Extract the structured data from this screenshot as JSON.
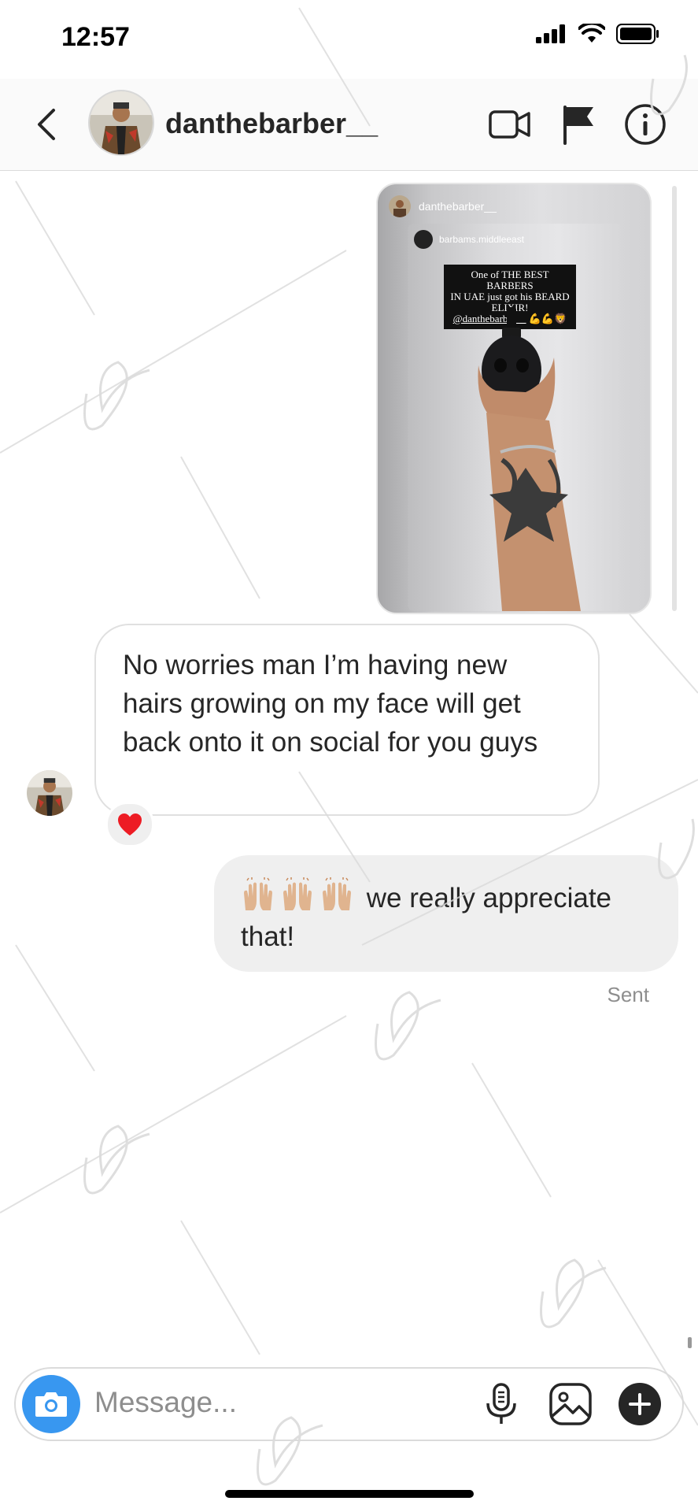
{
  "status_bar": {
    "time": "12:57"
  },
  "header": {
    "username": "danthebarber__"
  },
  "story": {
    "owner": "danthebarber__",
    "inner_owner": "barbams.middleeast",
    "caption_line1": "One of THE BEST BARBERS",
    "caption_line2": "IN UAE just got his BEARD",
    "caption_line3": "ELIXIR!",
    "caption_mention": "@danthebarber__",
    "caption_emoji": "💪💪🦁"
  },
  "messages": {
    "incoming_text": "No worries man I’m having new hairs growing on my face will get back onto it on social for you guys",
    "reaction": "❤️",
    "outgoing_emoji": "🙌🏼🙌🏼🙌🏼",
    "outgoing_text": "we really appreciate that!",
    "status": "Sent"
  },
  "composer": {
    "placeholder": "Message..."
  },
  "colors": {
    "accent": "#3897f0",
    "bubble_out": "#efefef",
    "heart": "#ed1c24"
  }
}
